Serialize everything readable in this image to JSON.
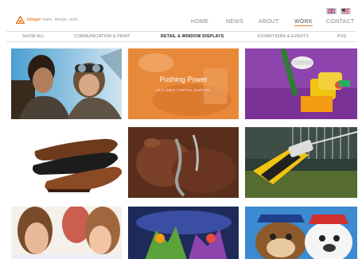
{
  "brand": {
    "name": "trilogic",
    "tagline": "make. design. work."
  },
  "flags": [
    "uk-flag-icon",
    "us-flag-icon"
  ],
  "nav": {
    "items": [
      {
        "label": "HOME",
        "active": false
      },
      {
        "label": "NEWS",
        "active": false
      },
      {
        "label": "ABOUT",
        "active": false
      },
      {
        "label": "WORK",
        "active": true
      },
      {
        "label": "CONTACT",
        "active": false
      }
    ]
  },
  "subnav": {
    "items": [
      {
        "label": "SHOW ALL",
        "active": false
      },
      {
        "label": "COMMUNICATION & PRINT",
        "active": false
      },
      {
        "label": "RETAIL & WINDOW DISPLAYS",
        "active": true
      },
      {
        "label": "EXHIBITIONS & EVENTS",
        "active": false
      },
      {
        "label": "POS",
        "active": false
      }
    ]
  },
  "tiles": [
    {
      "name": "star-wars-characters",
      "overlay": null
    },
    {
      "name": "pushing-power",
      "overlay": {
        "title": "Pushing Power",
        "subtitle": "OLCADEO / RETAIL DISPLAY"
      }
    },
    {
      "name": "lego-minifig",
      "overlay": null
    },
    {
      "name": "leather-shoes",
      "overlay": null
    },
    {
      "name": "chocolate-pour",
      "overlay": null
    },
    {
      "name": "power-tool",
      "overlay": null
    },
    {
      "name": "girls-smiling",
      "overlay": null
    },
    {
      "name": "skylanders-figures",
      "overlay": null
    },
    {
      "name": "paw-patrol",
      "overlay": null
    }
  ],
  "colors": {
    "accent": "#e67e22",
    "overlay": "#e8893a"
  }
}
